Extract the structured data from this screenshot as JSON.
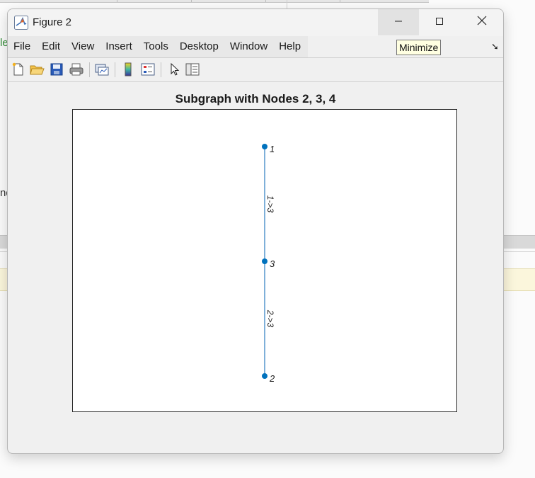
{
  "window": {
    "title": "Figure 2",
    "controls": {
      "minimize": "minimize-icon",
      "maximize": "maximize-icon",
      "close": "close-icon"
    }
  },
  "menu": [
    "File",
    "Edit",
    "View",
    "Insert",
    "Tools",
    "Desktop",
    "Window",
    "Help"
  ],
  "tooltip": "Minimize",
  "toolbar": {
    "icons": [
      "new-figure-icon",
      "open-file-icon",
      "save-icon",
      "print-icon",
      "link-plot-icon",
      "colorbar-icon",
      "legend-icon",
      "edit-plot-icon",
      "property-inspector-icon"
    ]
  },
  "plot": {
    "title": "Subgraph with Nodes 2, 3, 4",
    "nodes": [
      {
        "label": "1"
      },
      {
        "label": "3"
      },
      {
        "label": "2"
      }
    ],
    "edges": [
      {
        "label": "1->3"
      },
      {
        "label": "2->3"
      }
    ],
    "colors": {
      "node": "#0072BD",
      "edge": "#7fb0d9"
    }
  },
  "background": {
    "fragment_green": "le",
    "fragment_dark": "nd"
  }
}
